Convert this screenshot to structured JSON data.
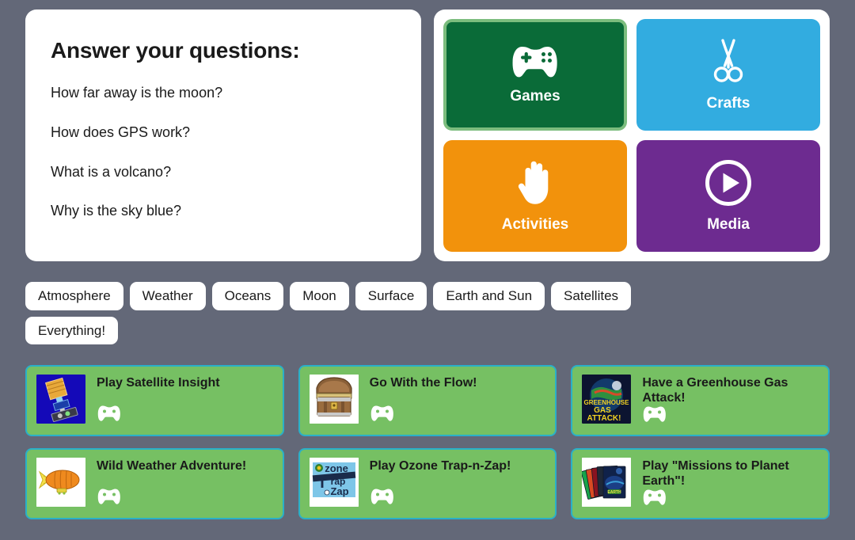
{
  "theme": {
    "page_background": "#636878",
    "panel_background": "#ffffff",
    "card_background": "#76c063",
    "card_border": "#2ab0c8",
    "selected_tile_border": "#7cbd7e",
    "text_dark": "#1a1a1a"
  },
  "questions_panel": {
    "title": "Answer your questions:",
    "items": [
      "How far away is the moon?",
      "How does GPS work?",
      "What is a volcano?",
      "Why is the sky blue?"
    ]
  },
  "category_tiles": [
    {
      "label": "Games",
      "color": "#0a6b38",
      "icon": "gamepad-icon",
      "selected": true
    },
    {
      "label": "Crafts",
      "color": "#32ackd",
      "icon": "scissors-icon",
      "selected": false
    },
    {
      "label": "Activities",
      "color": "#f2920c",
      "icon": "hand-icon",
      "selected": false
    },
    {
      "label": "Media",
      "color": "#6d2b90",
      "icon": "play-icon",
      "selected": false
    }
  ],
  "tile_colors": {
    "games": "#0a6b38",
    "crafts": "#32ace0",
    "activities": "#f2920c",
    "media": "#6d2b90"
  },
  "filter_chips": [
    "Atmosphere",
    "Weather",
    "Oceans",
    "Moon",
    "Surface",
    "Earth and Sun",
    "Satellites",
    "Everything!"
  ],
  "result_cards": [
    {
      "title": "Play Satellite Insight",
      "thumbnail": "satellite-thumbnail",
      "type_icon": "gamepad-icon"
    },
    {
      "title": "Go With the Flow!",
      "thumbnail": "treasure-chest-thumbnail",
      "type_icon": "gamepad-icon"
    },
    {
      "title": "Have a Greenhouse Gas Attack!",
      "thumbnail": "greenhouse-gas-attack-thumbnail",
      "type_icon": "gamepad-icon"
    },
    {
      "title": "Wild Weather Adventure!",
      "thumbnail": "blimp-thumbnail",
      "type_icon": "gamepad-icon"
    },
    {
      "title": "Play Ozone Trap-n-Zap!",
      "thumbnail": "ozone-trap-n-zap-thumbnail",
      "type_icon": "gamepad-icon"
    },
    {
      "title": "Play \"Missions to Planet Earth\"!",
      "thumbnail": "cd-cases-thumbnail",
      "type_icon": "gamepad-icon"
    }
  ]
}
